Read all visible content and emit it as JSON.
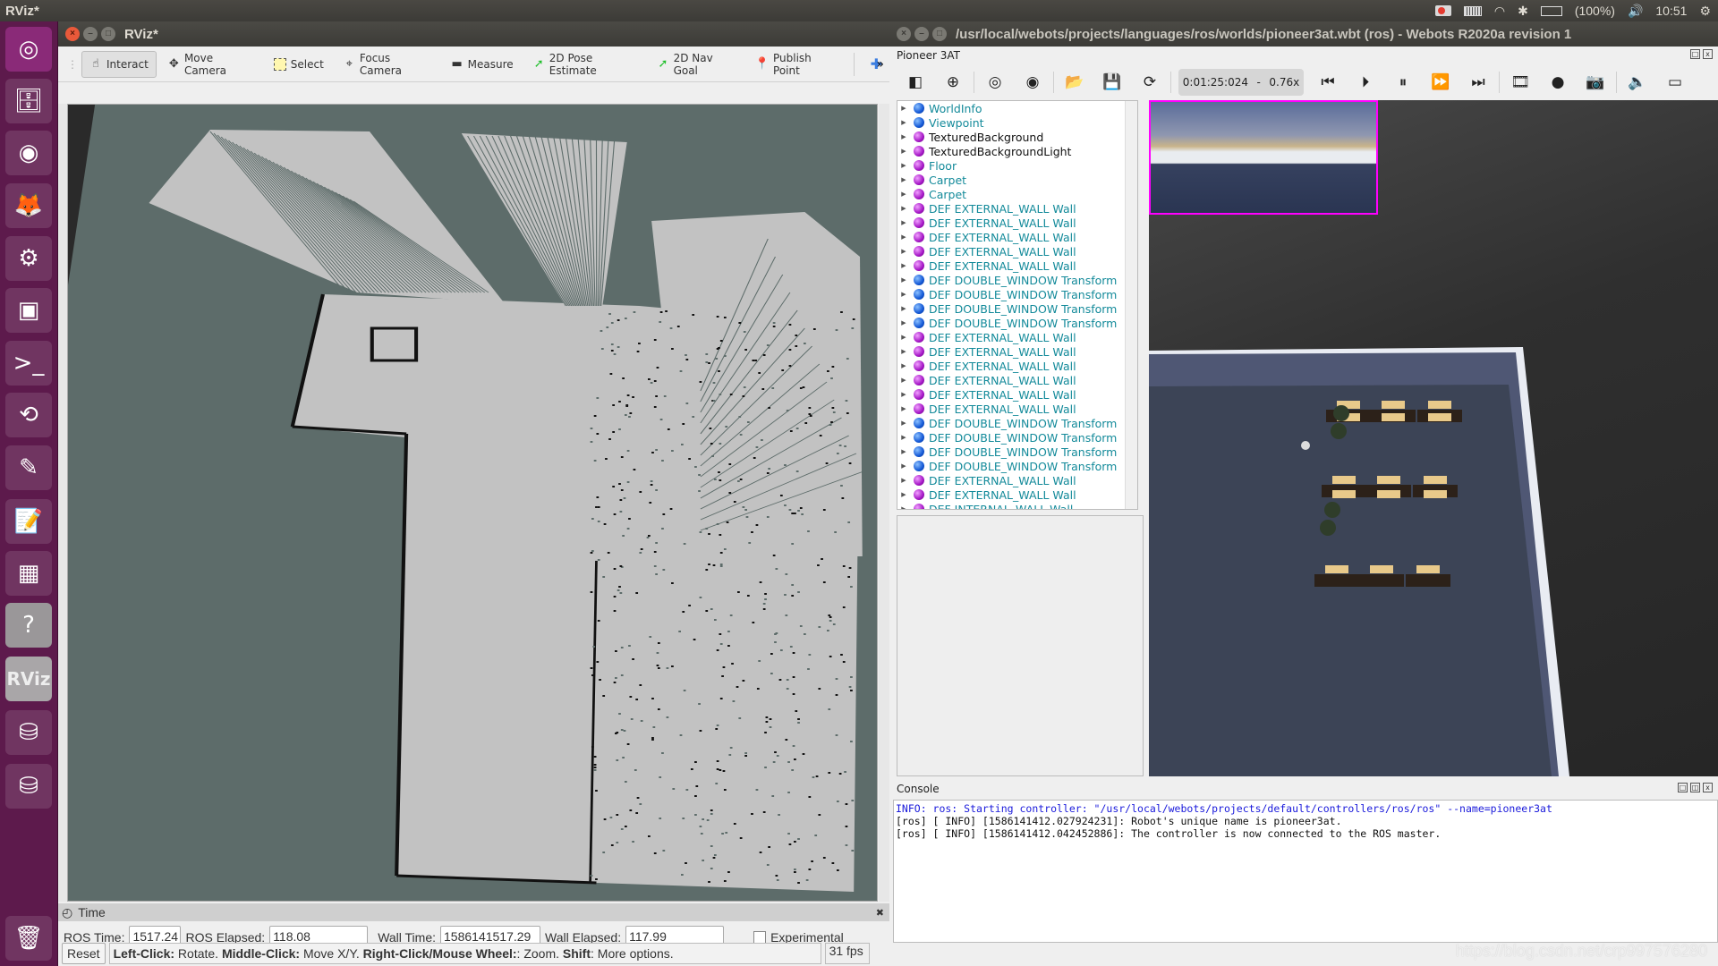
{
  "topbar": {
    "app_name": "RViz*",
    "battery": "(100%)",
    "clock": "10:51"
  },
  "launcher": {
    "items": [
      {
        "name": "ubuntu-dash",
        "glyph": "◎"
      },
      {
        "name": "files",
        "glyph": "🗄"
      },
      {
        "name": "chrome",
        "glyph": "◉"
      },
      {
        "name": "firefox",
        "glyph": "🦊"
      },
      {
        "name": "system-settings",
        "glyph": "⚙"
      },
      {
        "name": "webcam-viewer",
        "glyph": "▣"
      },
      {
        "name": "terminal",
        "glyph": ">_"
      },
      {
        "name": "software-updater",
        "glyph": "⟲"
      },
      {
        "name": "color-pencils",
        "glyph": "✎"
      },
      {
        "name": "text-editor",
        "glyph": "📝"
      },
      {
        "name": "workspace-switcher",
        "glyph": "▦"
      },
      {
        "name": "help",
        "glyph": "?"
      },
      {
        "name": "rviz",
        "glyph": "RViz"
      },
      {
        "name": "disk-1",
        "glyph": "⛁"
      },
      {
        "name": "disk-2",
        "glyph": "⛁"
      },
      {
        "name": "trash",
        "glyph": "🗑"
      }
    ]
  },
  "rviz": {
    "title": "RViz*",
    "toolbar": [
      {
        "label": "Interact",
        "icon": "hand-icon",
        "glyph": "☝",
        "active": true
      },
      {
        "label": "Move Camera",
        "icon": "move-camera-icon",
        "glyph": "✥",
        "active": false
      },
      {
        "label": "Select",
        "icon": "select-icon",
        "glyph": "▭",
        "active": false
      },
      {
        "label": "Focus Camera",
        "icon": "focus-camera-icon",
        "glyph": "⌖",
        "active": false
      },
      {
        "label": "Measure",
        "icon": "ruler-icon",
        "glyph": "▬",
        "active": false
      },
      {
        "label": "2D Pose Estimate",
        "icon": "green-arrow-icon",
        "glyph": "➚",
        "active": false
      },
      {
        "label": "2D Nav Goal",
        "icon": "green-arrow-icon",
        "glyph": "➚",
        "active": false
      },
      {
        "label": "Publish Point",
        "icon": "map-pin-icon",
        "glyph": "📍",
        "active": false
      }
    ],
    "add_tool_glyph": "✚",
    "overflow_glyph": "»",
    "time_panel": {
      "title": "Time",
      "ros_time_label": "ROS Time:",
      "ros_time": "1517.24",
      "ros_elapsed_label": "ROS Elapsed:",
      "ros_elapsed": "118.08",
      "wall_time_label": "Wall Time:",
      "wall_time": "1586141517.29",
      "wall_elapsed_label": "Wall Elapsed:",
      "wall_elapsed": "117.99",
      "experimental_label": "Experimental",
      "experimental_checked": false
    },
    "status": {
      "reset_label": "Reset",
      "hint_parts": [
        {
          "bold": "Left-Click:",
          "text": " Rotate. "
        },
        {
          "bold": "Middle-Click:",
          "text": " Move X/Y. "
        },
        {
          "bold": "Right-Click/Mouse Wheel:",
          "text": ": Zoom. "
        },
        {
          "bold": "Shift",
          "text": ": More options."
        }
      ],
      "fps": "31 fps"
    },
    "colors": {
      "map_unknown": "#5d6c6a",
      "map_free": "#c2c2c2",
      "map_occupied": "#111111"
    }
  },
  "webots": {
    "title": "/usr/local/webots/projects/languages/ros/worlds/pioneer3at.wbt (ros) - Webots R2020a revision 1",
    "pane_title": "Pioneer 3AT",
    "sim_time": "0:01:25:024",
    "sim_speed": "0.76x",
    "time_sep": "-",
    "toolbar_icons": [
      {
        "name": "toggle-scene-tree-icon",
        "glyph": "◧"
      },
      {
        "name": "add-node-icon",
        "glyph": "⊕"
      },
      {
        "name": "viewpoint-follow-icon",
        "glyph": "◎"
      },
      {
        "name": "view-icon",
        "glyph": "◉"
      },
      {
        "name": "open-world-icon",
        "glyph": "📂"
      },
      {
        "name": "save-world-icon",
        "glyph": "💾"
      },
      {
        "name": "reload-world-icon",
        "glyph": "⟳"
      }
    ],
    "playback_icons": [
      {
        "name": "reset-simulation-icon",
        "glyph": "⏮"
      },
      {
        "name": "step-icon",
        "glyph": "⏵"
      },
      {
        "name": "pause-icon",
        "glyph": "⏸"
      },
      {
        "name": "run-icon",
        "glyph": "⏩"
      },
      {
        "name": "fast-icon",
        "glyph": "⏭"
      },
      {
        "name": "record-movie-icon",
        "glyph": "🎞"
      },
      {
        "name": "record-animation-icon",
        "glyph": "●"
      },
      {
        "name": "screenshot-icon",
        "glyph": "📷"
      },
      {
        "name": "mute-icon",
        "glyph": "🔈"
      },
      {
        "name": "volume-slider-icon",
        "glyph": "▭"
      }
    ],
    "scene_tree": [
      {
        "label": "WorldInfo",
        "ball": "blue",
        "color": "teal"
      },
      {
        "label": "Viewpoint",
        "ball": "blue",
        "color": "teal"
      },
      {
        "label": "TexturedBackground",
        "ball": "purple",
        "color": "black"
      },
      {
        "label": "TexturedBackgroundLight",
        "ball": "purple",
        "color": "black"
      },
      {
        "label": "Floor",
        "ball": "purple",
        "color": "teal"
      },
      {
        "label": "Carpet",
        "ball": "purple",
        "color": "teal"
      },
      {
        "label": "Carpet",
        "ball": "purple",
        "color": "teal"
      },
      {
        "label": "DEF EXTERNAL_WALL Wall",
        "ball": "purple",
        "color": "teal"
      },
      {
        "label": "DEF EXTERNAL_WALL Wall",
        "ball": "purple",
        "color": "teal"
      },
      {
        "label": "DEF EXTERNAL_WALL Wall",
        "ball": "purple",
        "color": "teal"
      },
      {
        "label": "DEF EXTERNAL_WALL Wall",
        "ball": "purple",
        "color": "teal"
      },
      {
        "label": "DEF EXTERNAL_WALL Wall",
        "ball": "purple",
        "color": "teal"
      },
      {
        "label": "DEF DOUBLE_WINDOW Transform",
        "ball": "blue",
        "color": "teal"
      },
      {
        "label": "DEF DOUBLE_WINDOW Transform",
        "ball": "blue",
        "color": "teal"
      },
      {
        "label": "DEF DOUBLE_WINDOW Transform",
        "ball": "blue",
        "color": "teal"
      },
      {
        "label": "DEF DOUBLE_WINDOW Transform",
        "ball": "blue",
        "color": "teal"
      },
      {
        "label": "DEF EXTERNAL_WALL Wall",
        "ball": "purple",
        "color": "teal"
      },
      {
        "label": "DEF EXTERNAL_WALL Wall",
        "ball": "purple",
        "color": "teal"
      },
      {
        "label": "DEF EXTERNAL_WALL Wall",
        "ball": "purple",
        "color": "teal"
      },
      {
        "label": "DEF EXTERNAL_WALL Wall",
        "ball": "purple",
        "color": "teal"
      },
      {
        "label": "DEF EXTERNAL_WALL Wall",
        "ball": "purple",
        "color": "teal"
      },
      {
        "label": "DEF EXTERNAL_WALL Wall",
        "ball": "purple",
        "color": "teal"
      },
      {
        "label": "DEF DOUBLE_WINDOW Transform",
        "ball": "blue",
        "color": "teal"
      },
      {
        "label": "DEF DOUBLE_WINDOW Transform",
        "ball": "blue",
        "color": "teal"
      },
      {
        "label": "DEF DOUBLE_WINDOW Transform",
        "ball": "blue",
        "color": "teal"
      },
      {
        "label": "DEF DOUBLE_WINDOW Transform",
        "ball": "blue",
        "color": "teal"
      },
      {
        "label": "DEF EXTERNAL_WALL Wall",
        "ball": "purple",
        "color": "teal"
      },
      {
        "label": "DEF EXTERNAL_WALL Wall",
        "ball": "purple",
        "color": "teal"
      },
      {
        "label": "DEF INTERNAL_WALL Wall",
        "ball": "purple",
        "color": "teal"
      }
    ],
    "console": {
      "title": "Console",
      "lines": [
        {
          "text": "INFO: ros: Starting controller: \"/usr/local/webots/projects/default/controllers/ros/ros\" --name=pioneer3at",
          "kind": "info-blue"
        },
        {
          "text": "[ros] [ INFO] [1586141412.027924231]: Robot's unique name is pioneer3at.",
          "kind": "normal"
        },
        {
          "text": "[ros] [ INFO] [1586141412.042452886]: The controller is now connected to the ROS master.",
          "kind": "normal"
        }
      ]
    },
    "watermark": "https://blog.csdn.net/crp997576280"
  }
}
